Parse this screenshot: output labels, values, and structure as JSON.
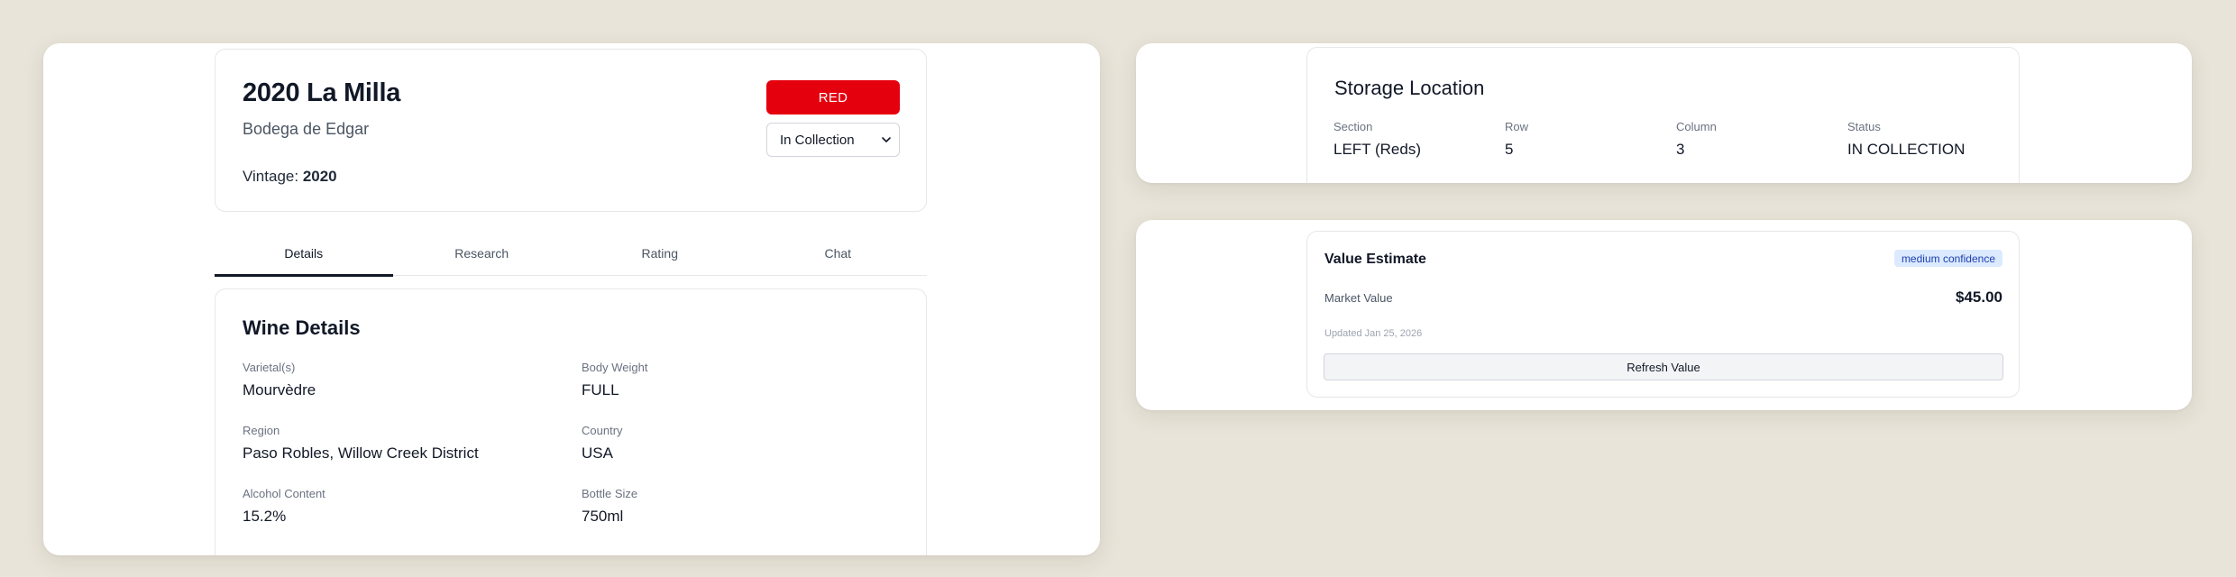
{
  "wine": {
    "title": "2020 La Milla",
    "producer": "Bodega de Edgar",
    "vintage_label": "Vintage:",
    "vintage_value": "2020",
    "type_badge": "RED",
    "type_badge_color": "#e5000e",
    "status_select": {
      "selected": "In Collection"
    }
  },
  "tabs": [
    {
      "label": "Details",
      "active": true
    },
    {
      "label": "Research",
      "active": false
    },
    {
      "label": "Rating",
      "active": false
    },
    {
      "label": "Chat",
      "active": false
    }
  ],
  "details": {
    "title": "Wine Details",
    "fields": [
      {
        "label": "Varietal(s)",
        "value": "Mourvèdre"
      },
      {
        "label": "Body Weight",
        "value": "FULL"
      },
      {
        "label": "Region",
        "value": "Paso Robles, Willow Creek District"
      },
      {
        "label": "Country",
        "value": "USA"
      },
      {
        "label": "Alcohol Content",
        "value": "15.2%"
      },
      {
        "label": "Bottle Size",
        "value": "750ml"
      }
    ]
  },
  "storage": {
    "title": "Storage Location",
    "fields": [
      {
        "label": "Section",
        "value": "LEFT (Reds)"
      },
      {
        "label": "Row",
        "value": "5"
      },
      {
        "label": "Column",
        "value": "3"
      },
      {
        "label": "Status",
        "value": "IN COLLECTION"
      }
    ]
  },
  "value_estimate": {
    "title": "Value Estimate",
    "confidence_badge": "medium confidence",
    "market_value_label": "Market Value",
    "market_value": "$45.00",
    "updated": "Updated Jan 25, 2026",
    "refresh_label": "Refresh Value"
  }
}
